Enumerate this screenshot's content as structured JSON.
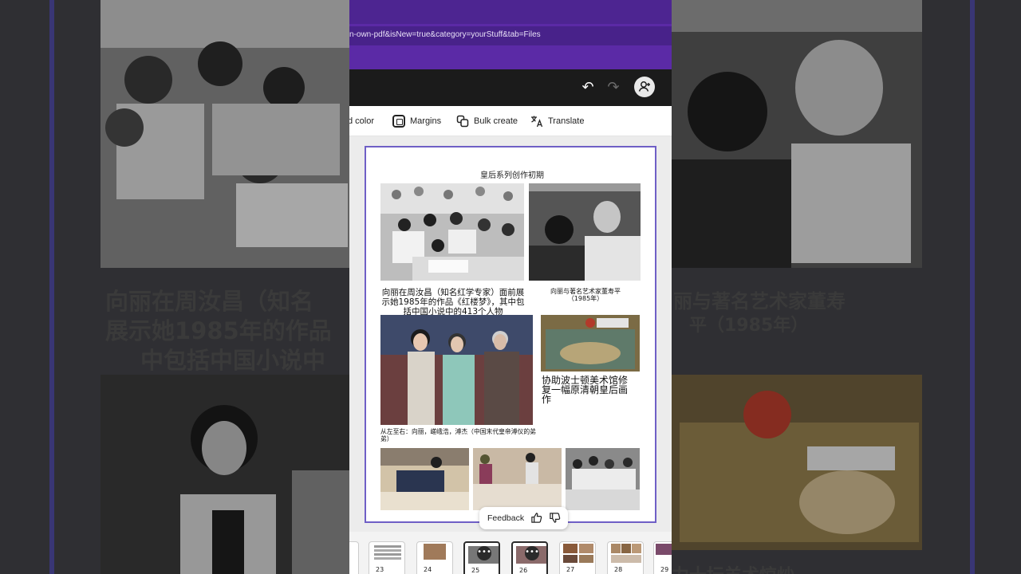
{
  "browser": {
    "url_fragment": "n-own-pdf&isNew=true&category=yourStuff&tab=Files"
  },
  "appbar": {
    "undo_icon": "↶",
    "redo_icon": "↷",
    "share_icon": "👤+",
    "more_icon": "⋮"
  },
  "toolbar": {
    "items": [
      {
        "label": "d color",
        "icon": "background-color-icon"
      },
      {
        "label": "Margins",
        "icon": "margins-icon"
      },
      {
        "label": "Bulk create",
        "icon": "bulk-create-icon"
      },
      {
        "label": "Translate",
        "icon": "translate-icon"
      }
    ]
  },
  "document": {
    "title": "皇后系列创作初期",
    "captions": {
      "top_left": "向丽在周汝昌（知名红学专家）面前展示她1985年的作品《红楼梦》，其中包括中国小说中的413个人物",
      "top_right": "向丽与著名艺术家董寿平（1985年）",
      "mid_left": "从左至右：向丽，嵯峨浩，溥杰（中国末代皇帝溥仪的弟弟）",
      "mid_right": "协助波士顿美术馆修复一幅原清朝皇后画作"
    }
  },
  "feedback": {
    "label": "Feedback",
    "like_icon": "thumbs-up-icon",
    "dislike_icon": "thumbs-down-icon"
  },
  "background_captions": {
    "left": [
      "向丽在周汝昌（知名",
      "展示她1985年的作品",
      "中包括中国小说中"
    ],
    "right": [
      "丽与著名艺术家董寿",
      "平（1985年）",
      "力十坛羊术惊炒"
    ]
  },
  "pages": [
    {
      "number": "23",
      "selected": false,
      "menu": false
    },
    {
      "number": "24",
      "selected": false,
      "menu": false
    },
    {
      "number": "25",
      "selected": true,
      "menu": true
    },
    {
      "number": "26",
      "selected": true,
      "menu": true
    },
    {
      "number": "27",
      "selected": false,
      "menu": false
    },
    {
      "number": "28",
      "selected": false,
      "menu": false
    },
    {
      "number": "29",
      "selected": false,
      "menu": false
    }
  ]
}
